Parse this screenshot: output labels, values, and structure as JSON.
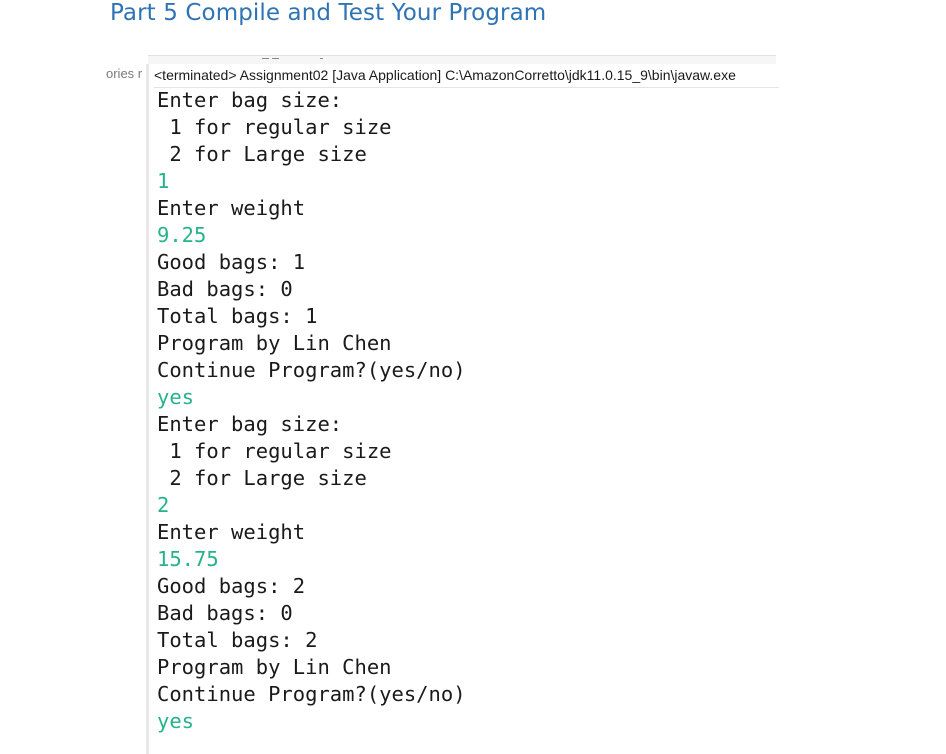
{
  "page": {
    "heading": "Part 5 Compile and Test Your Program"
  },
  "left_panel_clip": "ories r",
  "console": {
    "header": "<terminated> Assignment02 [Java Application] C:\\AmazonCorretto\\jdk11.0.15_9\\bin\\javaw.exe",
    "lines": [
      {
        "text": "Enter bag size:",
        "kind": "output"
      },
      {
        "text": " 1 for regular size",
        "kind": "output"
      },
      {
        "text": " 2 for Large size",
        "kind": "output"
      },
      {
        "text": "1",
        "kind": "input"
      },
      {
        "text": "Enter weight",
        "kind": "output"
      },
      {
        "text": "9.25",
        "kind": "input"
      },
      {
        "text": "Good bags: 1",
        "kind": "output"
      },
      {
        "text": "Bad bags: 0",
        "kind": "output"
      },
      {
        "text": "Total bags: 1",
        "kind": "output"
      },
      {
        "text": "Program by Lin Chen",
        "kind": "output"
      },
      {
        "text": "Continue Program?(yes/no)",
        "kind": "output"
      },
      {
        "text": "yes",
        "kind": "input"
      },
      {
        "text": "Enter bag size:",
        "kind": "output"
      },
      {
        "text": " 1 for regular size",
        "kind": "output"
      },
      {
        "text": " 2 for Large size",
        "kind": "output"
      },
      {
        "text": "2",
        "kind": "input"
      },
      {
        "text": "Enter weight",
        "kind": "output"
      },
      {
        "text": "15.75",
        "kind": "input"
      },
      {
        "text": "Good bags: 2",
        "kind": "output"
      },
      {
        "text": "Bad bags: 0",
        "kind": "output"
      },
      {
        "text": "Total bags: 2",
        "kind": "output"
      },
      {
        "text": "Program by Lin Chen",
        "kind": "output"
      },
      {
        "text": "Continue Program?(yes/no)",
        "kind": "output"
      },
      {
        "text": "yes",
        "kind": "input"
      }
    ]
  },
  "colors": {
    "heading": "#2e74b5",
    "output_text": "#1a1a1a",
    "input_text": "#26b38a"
  }
}
